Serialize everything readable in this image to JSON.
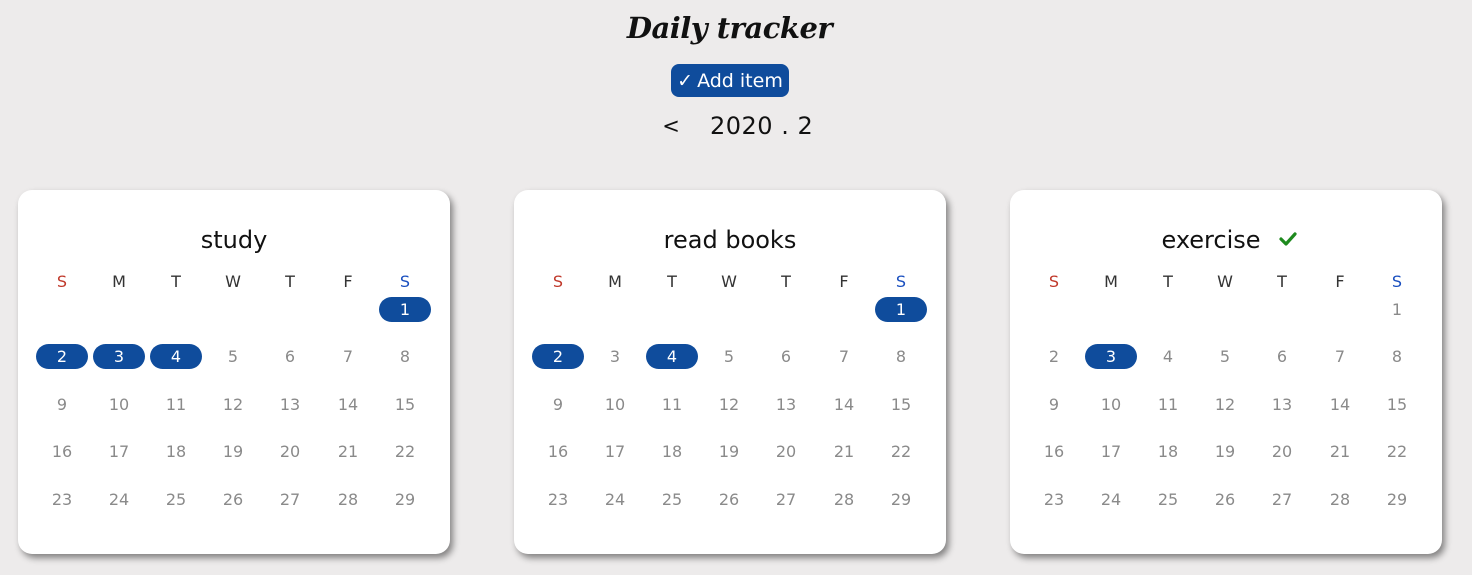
{
  "header": {
    "title": "Daily tracker",
    "add_button_icon": "✓",
    "add_button_label": "Add item",
    "prev_label": "<",
    "month_label": "2020 . 2"
  },
  "colors": {
    "accent": "#0f4c9c",
    "sunday": "#c0392b",
    "saturday": "#1a4fbf",
    "done_check": "#1e8a1e"
  },
  "weekdays": [
    "S",
    "M",
    "T",
    "W",
    "T",
    "F",
    "S"
  ],
  "calendar": {
    "first_weekday": 6,
    "days_in_month": 29
  },
  "trackers": [
    {
      "title": "study",
      "done": false,
      "marked": [
        1,
        2,
        3,
        4
      ]
    },
    {
      "title": "read books",
      "done": false,
      "marked": [
        1,
        2,
        4
      ]
    },
    {
      "title": "exercise",
      "done": true,
      "marked": [
        3
      ]
    }
  ]
}
